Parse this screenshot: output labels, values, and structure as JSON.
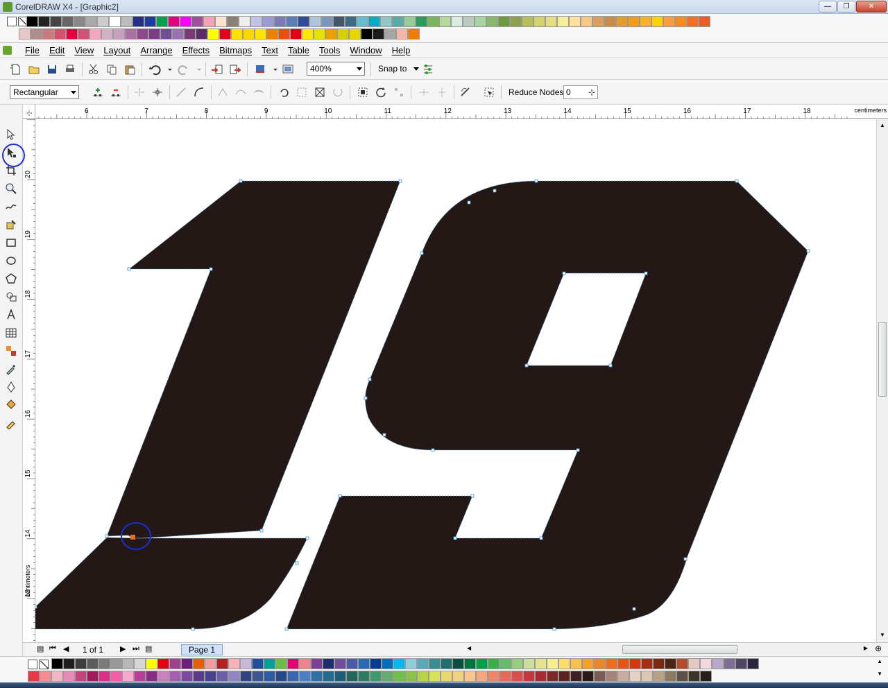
{
  "window": {
    "title": "CorelDRAW X4 - [Graphic2]"
  },
  "menu": {
    "items": [
      "File",
      "Edit",
      "View",
      "Layout",
      "Arrange",
      "Effects",
      "Bitmaps",
      "Text",
      "Table",
      "Tools",
      "Window",
      "Help"
    ]
  },
  "toolbar_standard": {
    "zoom_value": "400%",
    "snap_label": "Snap to"
  },
  "toolbar_property": {
    "mode_value": "Rectangular",
    "reduce_nodes_label": "Reduce Nodes",
    "reduce_nodes_value": "0"
  },
  "ruler": {
    "top_ticks": [
      "6",
      "7",
      "8",
      "9",
      "10",
      "11",
      "12",
      "13",
      "14",
      "15",
      "16",
      "17",
      "18"
    ],
    "left_ticks": [
      "20",
      "19",
      "18",
      "17",
      "16",
      "15",
      "14",
      "13"
    ],
    "units": "centimeters"
  },
  "page_nav": {
    "page_count": "1 of 1",
    "page_tab": "Page 1"
  },
  "colors": {
    "shape_fill": "#231816",
    "annotation": "#1a2ed8",
    "selected_node": "#e0701c"
  },
  "palette_top_row1": [
    "#000000",
    "#222222",
    "#444444",
    "#666666",
    "#888888",
    "#aaaaaa",
    "#cccccc",
    "#ffffff",
    "#bbbbbb",
    "#262f86",
    "#1f3b9c",
    "#00a14b",
    "#e4007f",
    "#ff00ff",
    "#a04f9c",
    "#f4a3b5",
    "#ffe2d0",
    "#8b7f76",
    "#eeeeee",
    "#c2c2e8",
    "#9b9bd2",
    "#7b7bb7",
    "#5b7eb9",
    "#2e4b9a",
    "#b0c4de",
    "#7a96ba",
    "#44546a",
    "#3d6b87",
    "#66bbcc",
    "#00aec7",
    "#8fc7c7",
    "#5ba9a9",
    "#99cc99",
    "#2b9c5e",
    "#78b45a",
    "#b5d99c",
    "#d9ece0",
    "#b8ccbf",
    "#a6d5a1",
    "#87b86e",
    "#6d9a3e",
    "#8ea050",
    "#b7bf5d",
    "#d3d26d",
    "#e6dd83",
    "#f6ee9b",
    "#ffe0a0",
    "#f8c886",
    "#d8a060",
    "#c98b49",
    "#e39c2d",
    "#f59a1b",
    "#f7b228",
    "#ffd100",
    "#ff9d3d",
    "#f68b1f",
    "#f36f21",
    "#f05a28"
  ],
  "palette_top_row2": [
    "#e6c7c7",
    "#b08b8b",
    "#c97a7a",
    "#d94f6b",
    "#e4003f",
    "#d64f76",
    "#f4a6c0",
    "#d4b0c6",
    "#c9a0c0",
    "#aa6fa3",
    "#8c4a8c",
    "#7a3d86",
    "#6f4f93",
    "#9973b1",
    "#7a3b77",
    "#5a2d68",
    "#ffff00",
    "#e2001a",
    "#ffe100",
    "#ffd700",
    "#ffe500",
    "#f08100",
    "#e94e0f",
    "#e50019",
    "#ffe800",
    "#e7e100",
    "#eaa000",
    "#d4d000",
    "#e9d500",
    "#000000",
    "#1a1a1a",
    "#a6a6a6",
    "#f4b5ab",
    "#ee7c00"
  ],
  "palette_bottom_row1": [
    "#000000",
    "#1f1f1f",
    "#3d3d3d",
    "#5c5c5c",
    "#7a7a7a",
    "#999999",
    "#b8b8b8",
    "#d6d6d6",
    "#ffff00",
    "#e60012",
    "#a0408c",
    "#6d1f7e",
    "#e85d00",
    "#f29c9f",
    "#b22222",
    "#f7b2b9",
    "#c8b7d8",
    "#1f4e9c",
    "#00a29a",
    "#6cbd45",
    "#e50074",
    "#ef858c",
    "#7d3f98",
    "#1e2d6b",
    "#6f4f9a",
    "#4a5aa8",
    "#2a6ab2",
    "#003d8f",
    "#006ebb",
    "#00b9f2",
    "#8fcdd9",
    "#5aa9bb",
    "#3b8c91",
    "#1f6f6f",
    "#0a4f3f",
    "#00743b",
    "#009e47",
    "#3aae49",
    "#66bb6a",
    "#96cf7f",
    "#ccdf9a",
    "#e4e48f",
    "#f8ee90",
    "#fcdc6b",
    "#f9c14e",
    "#f4a12b",
    "#f0862b",
    "#ef6c1e",
    "#ea5413",
    "#d4380e",
    "#a82d12",
    "#7b2810",
    "#4d2313",
    "#b44b2a",
    "#e5c9c0",
    "#f2d7e2",
    "#b9a9c9",
    "#7d6e93",
    "#4f4663",
    "#2b2540"
  ],
  "palette_bottom_row2": [
    "#e63946",
    "#f48c94",
    "#f2b5c3",
    "#e889b8",
    "#c4427f",
    "#a0195a",
    "#d8318a",
    "#f25fa6",
    "#f9a7cd",
    "#b93c96",
    "#8a2b87",
    "#cc7fbf",
    "#a45fb0",
    "#7b4aa0",
    "#5b3a8c",
    "#49418e",
    "#6a5fa8",
    "#8e85c2",
    "#30457f",
    "#3e5592",
    "#2f5ba1",
    "#28468a",
    "#3b67b0",
    "#4a81c5",
    "#2e71a8",
    "#216c93",
    "#1d5c7a",
    "#24645a",
    "#2d7c62",
    "#3d9a6f",
    "#65ab6d",
    "#6fbf4a",
    "#8bc34a",
    "#b5d447",
    "#d6e259",
    "#e9d86c",
    "#f2d180",
    "#fac48d",
    "#f5a77c",
    "#ec8869",
    "#e46b59",
    "#d94f4a",
    "#c3393d",
    "#a62b33",
    "#7f2a2a",
    "#5c2222",
    "#3e1f1f",
    "#2a1a17",
    "#7b5b54",
    "#a68479",
    "#c9aba0",
    "#e6d1c7",
    "#dcc7b2",
    "#b7a288",
    "#8c7a60",
    "#5c5142",
    "#3c3429",
    "#251f18"
  ]
}
